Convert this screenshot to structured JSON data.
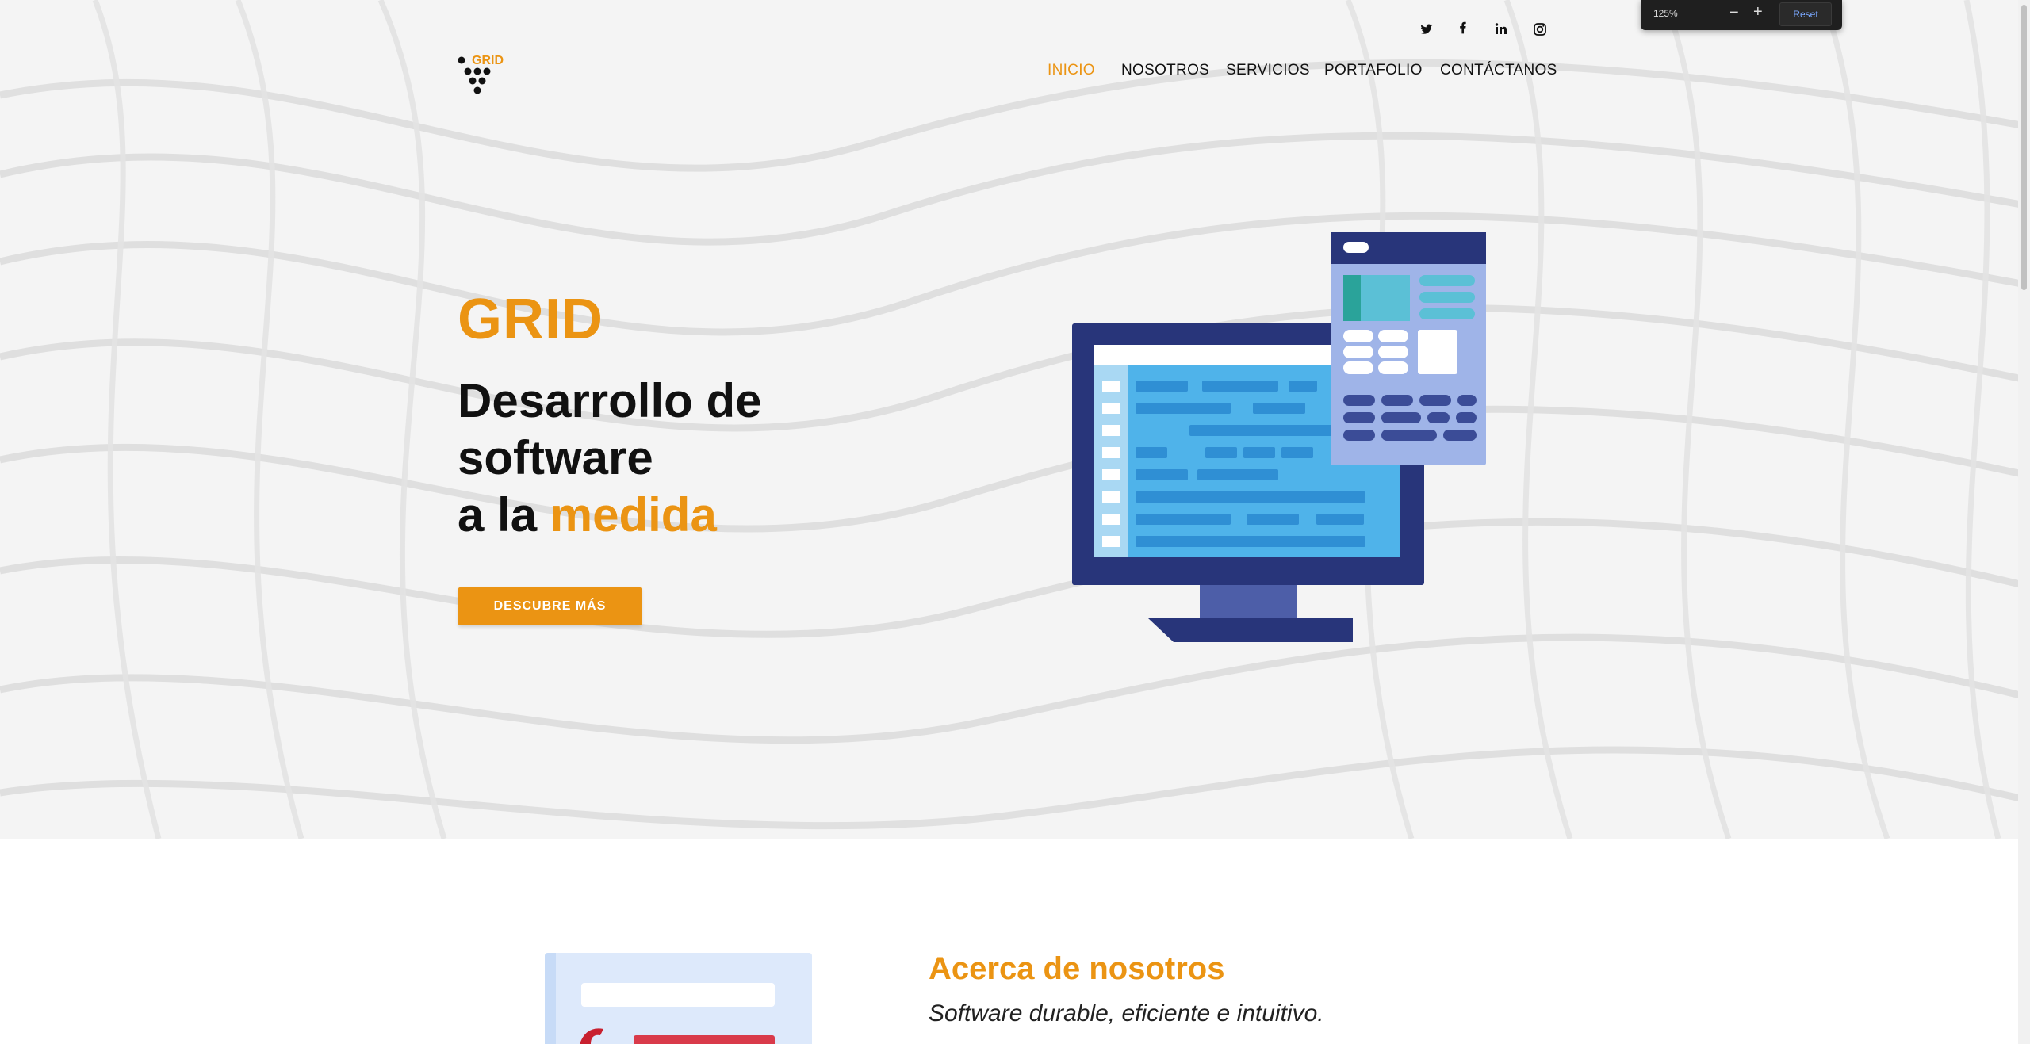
{
  "browser": {
    "zoom_level": "125%",
    "zoom_out": "−",
    "zoom_in": "+",
    "zoom_reset": "Reset"
  },
  "social": [
    "twitter-icon",
    "facebook-icon",
    "linkedin-icon",
    "instagram-icon"
  ],
  "logo": {
    "text": "GRID"
  },
  "nav": {
    "items": [
      "INICIO",
      "NOSOTROS",
      "SERVICIOS",
      "PORTAFOLIO",
      "CONTÁCTANOS"
    ],
    "active": "INICIO"
  },
  "hero": {
    "brand": "GRID",
    "line1": "Desarrollo de",
    "line2": "software",
    "line3_prefix": "a la ",
    "line3_accent": "medida",
    "cta": "DESCUBRE MÁS"
  },
  "about": {
    "title": "Acerca de nosotros",
    "subtitle": "Software durable, eficiente e intuitivo."
  },
  "colors": {
    "accent": "#eb9413",
    "navy": "#28357a",
    "screen_blue": "#4fb3ea"
  }
}
